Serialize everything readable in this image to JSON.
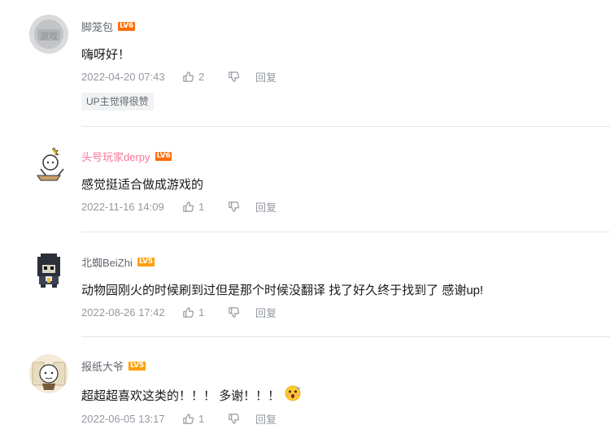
{
  "comments": [
    {
      "username": "脚笼包",
      "level": "LV6",
      "level_color": "#ff6c00",
      "text": "嗨呀好！",
      "time": "2022-04-20 07:43",
      "likes": "2",
      "reply_label": "回复",
      "up_tag": "UP主觉得很赞"
    },
    {
      "username": "头号玩家derpy",
      "username_color": "#fb7299",
      "level": "LV6",
      "level_color": "#ff6c00",
      "text": "感觉挺适合做成游戏的",
      "time": "2022-11-16 14:09",
      "likes": "1",
      "reply_label": "回复"
    },
    {
      "username": "北蜘BeiZhi",
      "level": "LV5",
      "level_color": "#ff9f00",
      "text": "动物园刚火的时候刷到过但是那个时候没翻译 找了好久终于找到了 感谢up!",
      "time": "2022-08-26 17:42",
      "likes": "1",
      "reply_label": "回复"
    },
    {
      "username": "报纸大爷",
      "level": "LV5",
      "level_color": "#ff9f00",
      "text": "超超超喜欢这类的！！！ 多谢！！！",
      "emoji": "surprised-face-emoji",
      "time": "2022-06-05 13:17",
      "likes": "1",
      "reply_label": "回复"
    }
  ],
  "watermark_text": "游戏"
}
